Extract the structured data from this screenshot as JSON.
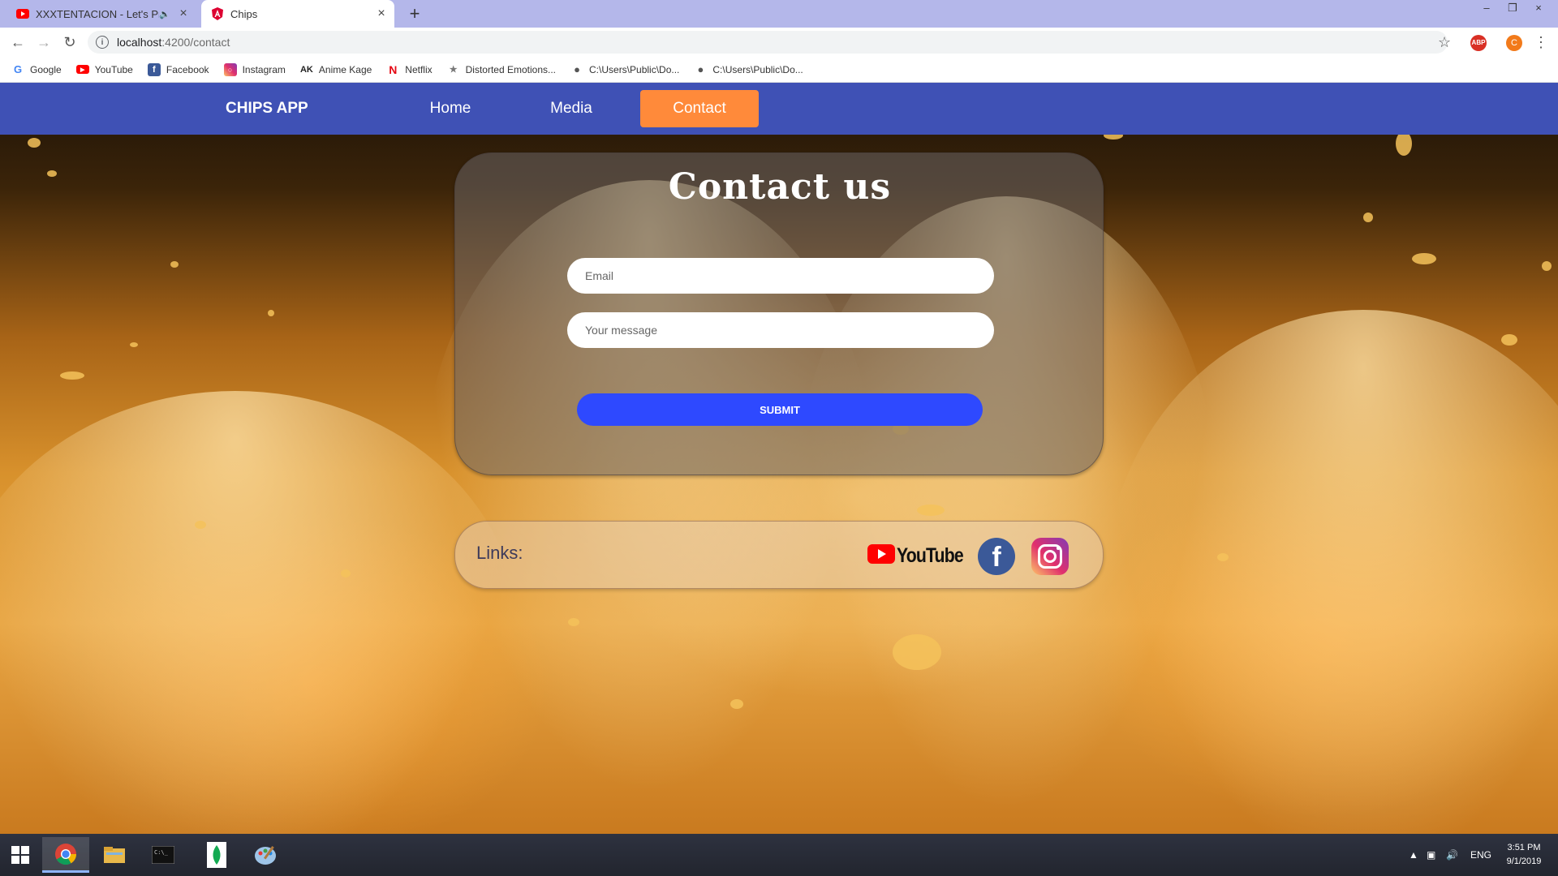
{
  "browser": {
    "tabs": [
      {
        "title": "XXXTENTACION - Let's Prete",
        "muted": true
      },
      {
        "title": "Chips",
        "active": true
      }
    ],
    "new_tab_symbol": "+",
    "url_host": "localhost",
    "url_rest": ":4200/contact",
    "profile_initial": "C",
    "bookmarks": [
      {
        "label": "Google",
        "icon": "google-icon"
      },
      {
        "label": "YouTube",
        "icon": "youtube-icon"
      },
      {
        "label": "Facebook",
        "icon": "facebook-icon"
      },
      {
        "label": "Instagram",
        "icon": "instagram-icon"
      },
      {
        "label": "Anime Kage",
        "icon": "anime-kage-icon"
      },
      {
        "label": "Netflix",
        "icon": "netflix-icon"
      },
      {
        "label": "Distorted Emotions...",
        "icon": "distorted-emotions-icon"
      },
      {
        "label": "C:\\Users\\Public\\Do...",
        "icon": "file-icon"
      },
      {
        "label": "C:\\Users\\Public\\Do...",
        "icon": "file-icon"
      }
    ]
  },
  "app": {
    "brand": "CHIPS APP",
    "nav": [
      {
        "label": "Home"
      },
      {
        "label": "Media"
      },
      {
        "label": "Contact",
        "active": true
      }
    ],
    "accent_color": "#ff8a3a",
    "nav_color": "#3f51b5"
  },
  "contact": {
    "title": "Contact us",
    "email_placeholder": "Email",
    "message_placeholder": "Your message",
    "submit_label": "SUBMIT",
    "submit_color": "#2e49ff"
  },
  "links": {
    "label": "Links:",
    "youtube_word": "YouTube",
    "facebook_letter": "f"
  },
  "taskbar": {
    "tray_lang": "ENG",
    "time": "3:51 PM",
    "date": "9/1/2019"
  }
}
